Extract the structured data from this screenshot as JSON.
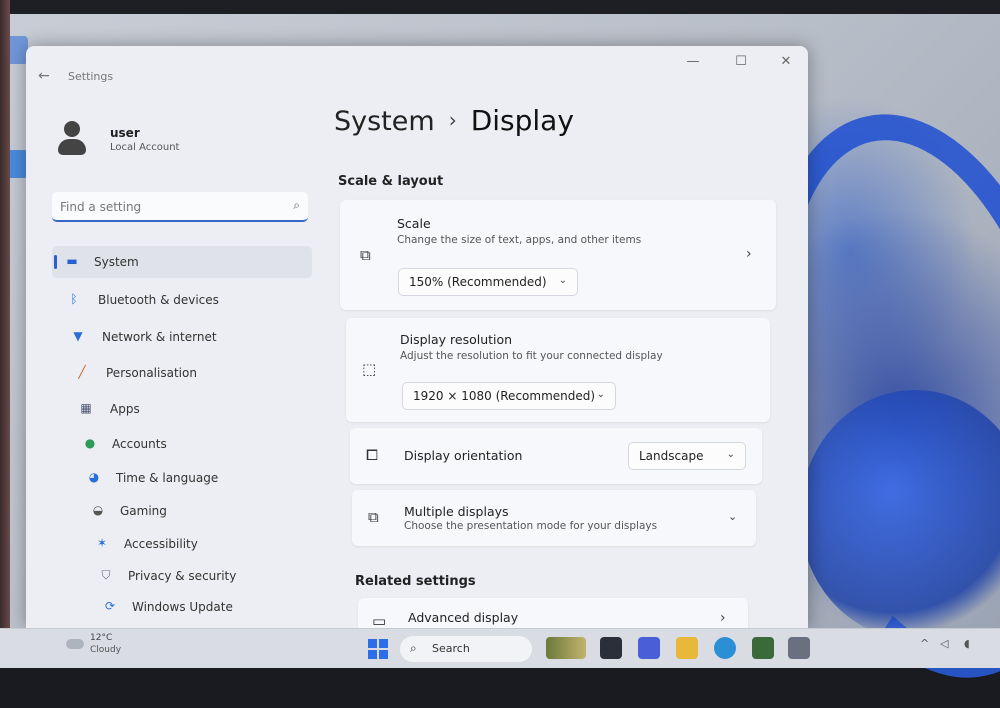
{
  "window": {
    "app_title": "Settings",
    "controls": {
      "minimize": "—",
      "maximize": "☐",
      "close": "✕"
    }
  },
  "user": {
    "name": "user",
    "account_type": "Local Account"
  },
  "search": {
    "placeholder": "Find a setting"
  },
  "sidebar": {
    "items": [
      {
        "label": "System",
        "icon": "system-icon",
        "color": "#2a5fcf",
        "active": true
      },
      {
        "label": "Bluetooth & devices",
        "icon": "bluetooth-icon",
        "color": "#2a6fd8"
      },
      {
        "label": "Network & internet",
        "icon": "wifi-icon",
        "color": "#2a6fd8"
      },
      {
        "label": "Personalisation",
        "icon": "brush-icon",
        "color": "#c9642a"
      },
      {
        "label": "Apps",
        "icon": "apps-icon",
        "color": "#4a5570"
      },
      {
        "label": "Accounts",
        "icon": "accounts-icon",
        "color": "#2f9a5a"
      },
      {
        "label": "Time & language",
        "icon": "globe-clock-icon",
        "color": "#2a6fd8"
      },
      {
        "label": "Gaming",
        "icon": "gamepad-icon",
        "color": "#555"
      },
      {
        "label": "Accessibility",
        "icon": "accessibility-icon",
        "color": "#2a6fd8"
      },
      {
        "label": "Privacy & security",
        "icon": "shield-icon",
        "color": "#6a6f7a"
      },
      {
        "label": "Windows Update",
        "icon": "update-icon",
        "color": "#2a6fd8"
      }
    ]
  },
  "breadcrumb": {
    "parent": "System",
    "separator": "›",
    "current": "Display"
  },
  "scale_layout": {
    "heading": "Scale & layout",
    "scale": {
      "title": "Scale",
      "subtitle": "Change the size of text, apps, and other items",
      "value": "150% (Recommended)"
    },
    "resolution": {
      "title": "Display resolution",
      "subtitle": "Adjust the resolution to fit your connected display",
      "value": "1920 × 1080 (Recommended)"
    },
    "orientation": {
      "title": "Display orientation",
      "value": "Landscape"
    },
    "multiple": {
      "title": "Multiple displays",
      "subtitle": "Choose the presentation mode for your displays"
    }
  },
  "related": {
    "heading": "Related settings",
    "advanced": {
      "title": "Advanced display"
    }
  },
  "taskbar": {
    "weather": {
      "temp": "12°C",
      "desc": "Cloudy"
    },
    "search_label": "Search"
  }
}
